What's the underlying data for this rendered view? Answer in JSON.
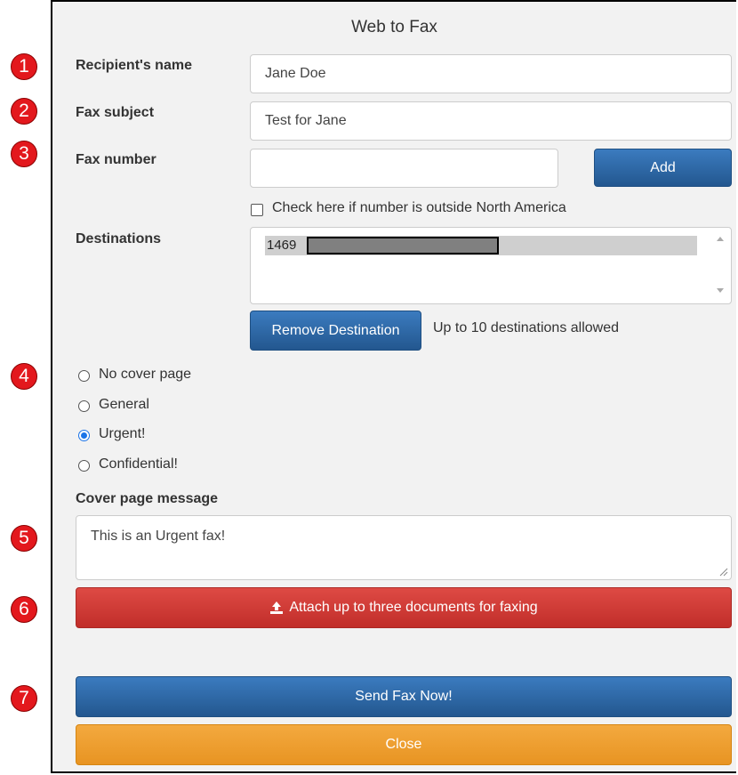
{
  "window": {
    "title": "Web to Fax"
  },
  "form": {
    "recipient_label": "Recipient's name",
    "recipient_value": "Jane Doe",
    "subject_label": "Fax subject",
    "subject_value": "Test for Jane",
    "fax_number_label": "Fax number",
    "fax_number_value": "",
    "add_label": "Add",
    "outside_na_label": "Check here if number is outside North America",
    "destinations_label": "Destinations",
    "destinations": [
      "1469"
    ],
    "remove_label": "Remove Destination",
    "limit_note": "Up to 10 destinations allowed",
    "cover_options": [
      {
        "label": "No cover page",
        "selected": false
      },
      {
        "label": "General",
        "selected": false
      },
      {
        "label": "Urgent!",
        "selected": true
      },
      {
        "label": "Confidential!",
        "selected": false
      }
    ],
    "cover_message_label": "Cover page message",
    "cover_message_value": "This is an Urgent fax!",
    "attach_label": "Attach up to three documents for faxing",
    "send_label": "Send Fax Now!",
    "close_label": "Close"
  },
  "markers": [
    "1",
    "2",
    "3",
    "4",
    "5",
    "6",
    "7"
  ],
  "colors": {
    "primary": "#23578f",
    "danger": "#c9302c",
    "warning": "#ec971f",
    "marker": "#e3181d",
    "radio_selected": "#1a73e8"
  }
}
